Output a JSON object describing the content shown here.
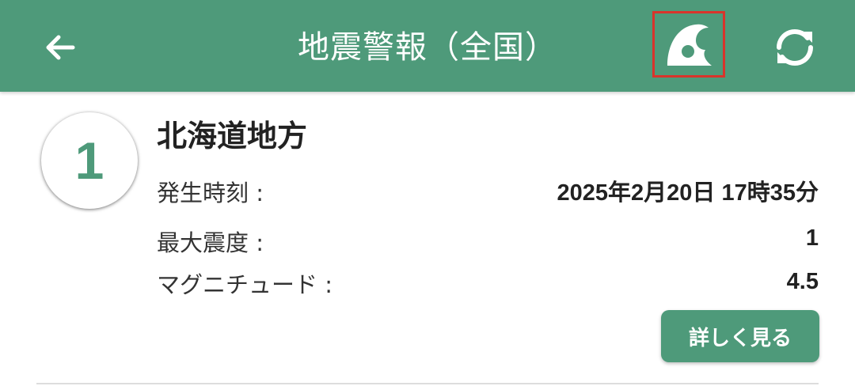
{
  "header": {
    "title": "地震警報（全国）",
    "back_icon": "arrow-left-icon",
    "tsunami_icon": "wave-icon",
    "refresh_icon": "refresh-icon",
    "background_color": "#4e9a7a",
    "highlight_color": "#d9342b"
  },
  "alerts": [
    {
      "index": "1",
      "region": "北海道地方",
      "occurred_label": "発生時刻 :",
      "occurred_value": "2025年2月20日 17時35分",
      "intensity_label": "最大震度 :",
      "intensity_value": "1",
      "magnitude_label": "マグニチュード :",
      "magnitude_value": "4.5",
      "detail_button": "詳しく見る"
    }
  ]
}
